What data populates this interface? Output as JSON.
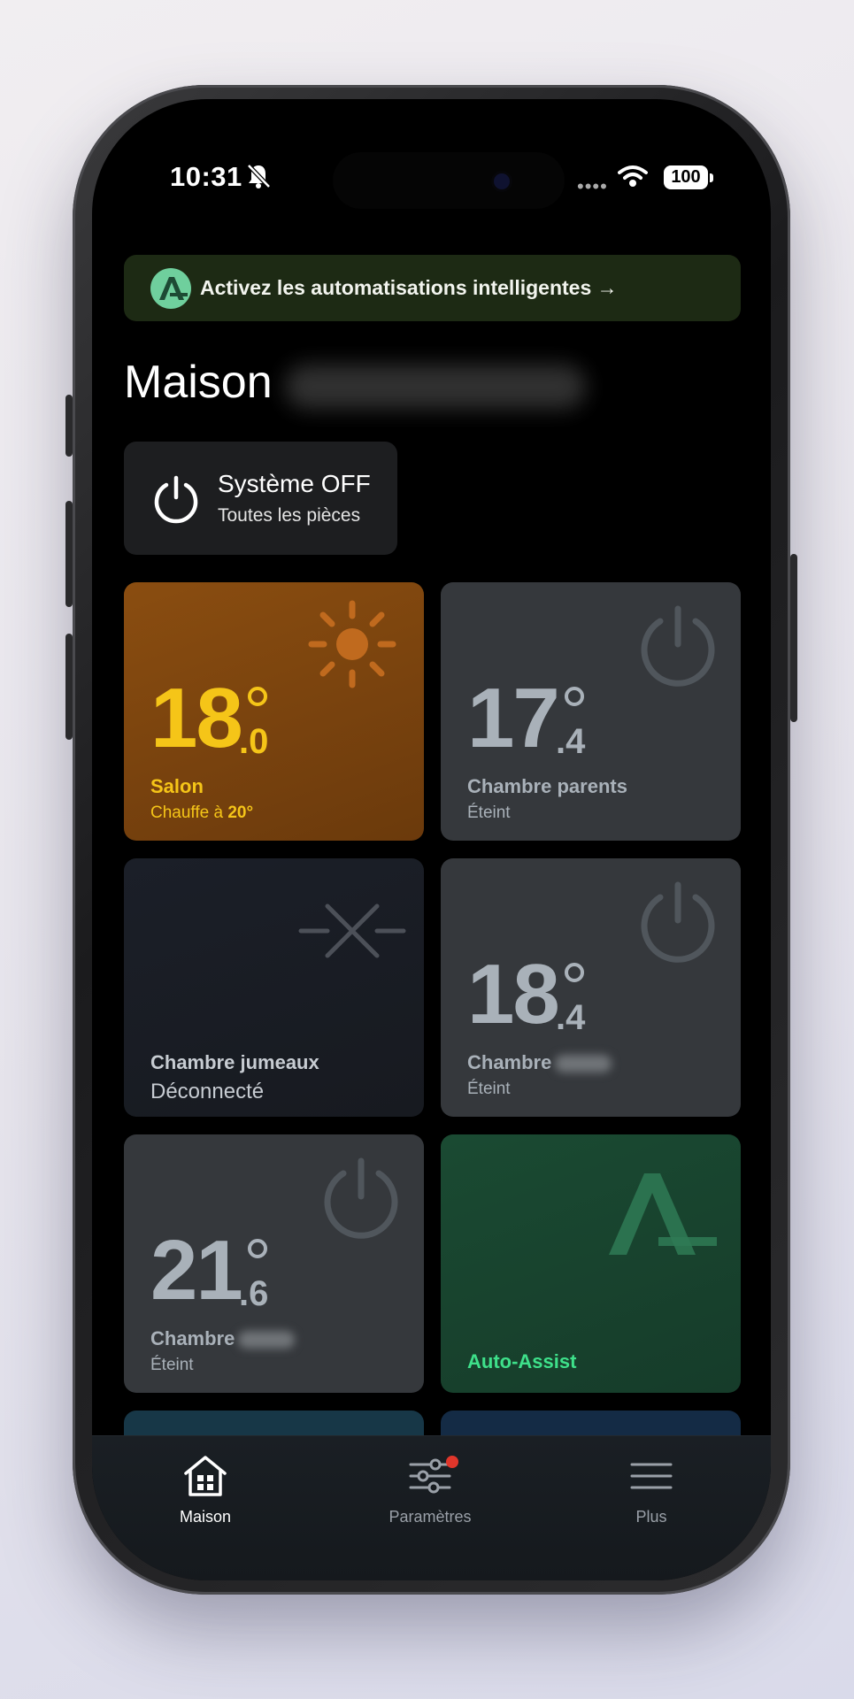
{
  "status_bar": {
    "time": "10:31",
    "battery": "100"
  },
  "banner": {
    "text": "Activez les automatisations intelligentes →"
  },
  "page": {
    "title": "Maison"
  },
  "system": {
    "title": "Système OFF",
    "subtitle": "Toutes les pièces"
  },
  "rooms": [
    {
      "name": "Salon",
      "temp_int": "18",
      "temp_dec": ".0",
      "status_prefix": "Chauffe à ",
      "status_value": "20°",
      "mode": "heating"
    },
    {
      "name": "Chambre parents",
      "temp_int": "17",
      "temp_dec": ".4",
      "status": "Éteint",
      "mode": "off"
    },
    {
      "name": "Chambre jumeaux",
      "status": "Déconnecté",
      "mode": "disconnected"
    },
    {
      "name": "Chambre",
      "temp_int": "18",
      "temp_dec": ".4",
      "status": "Éteint",
      "mode": "off"
    },
    {
      "name": "Chambre",
      "temp_int": "21",
      "temp_dec": ".6",
      "status": "Éteint",
      "mode": "off"
    }
  ],
  "auto_assist": {
    "label": "Auto-Assist"
  },
  "nav": {
    "home": "Maison",
    "settings": "Paramètres",
    "more": "Plus"
  },
  "colors": {
    "heating": "#f5c518",
    "off_text": "#a9b1b9",
    "auto_assist": "#3ee08a",
    "notification": "#e0362b"
  }
}
